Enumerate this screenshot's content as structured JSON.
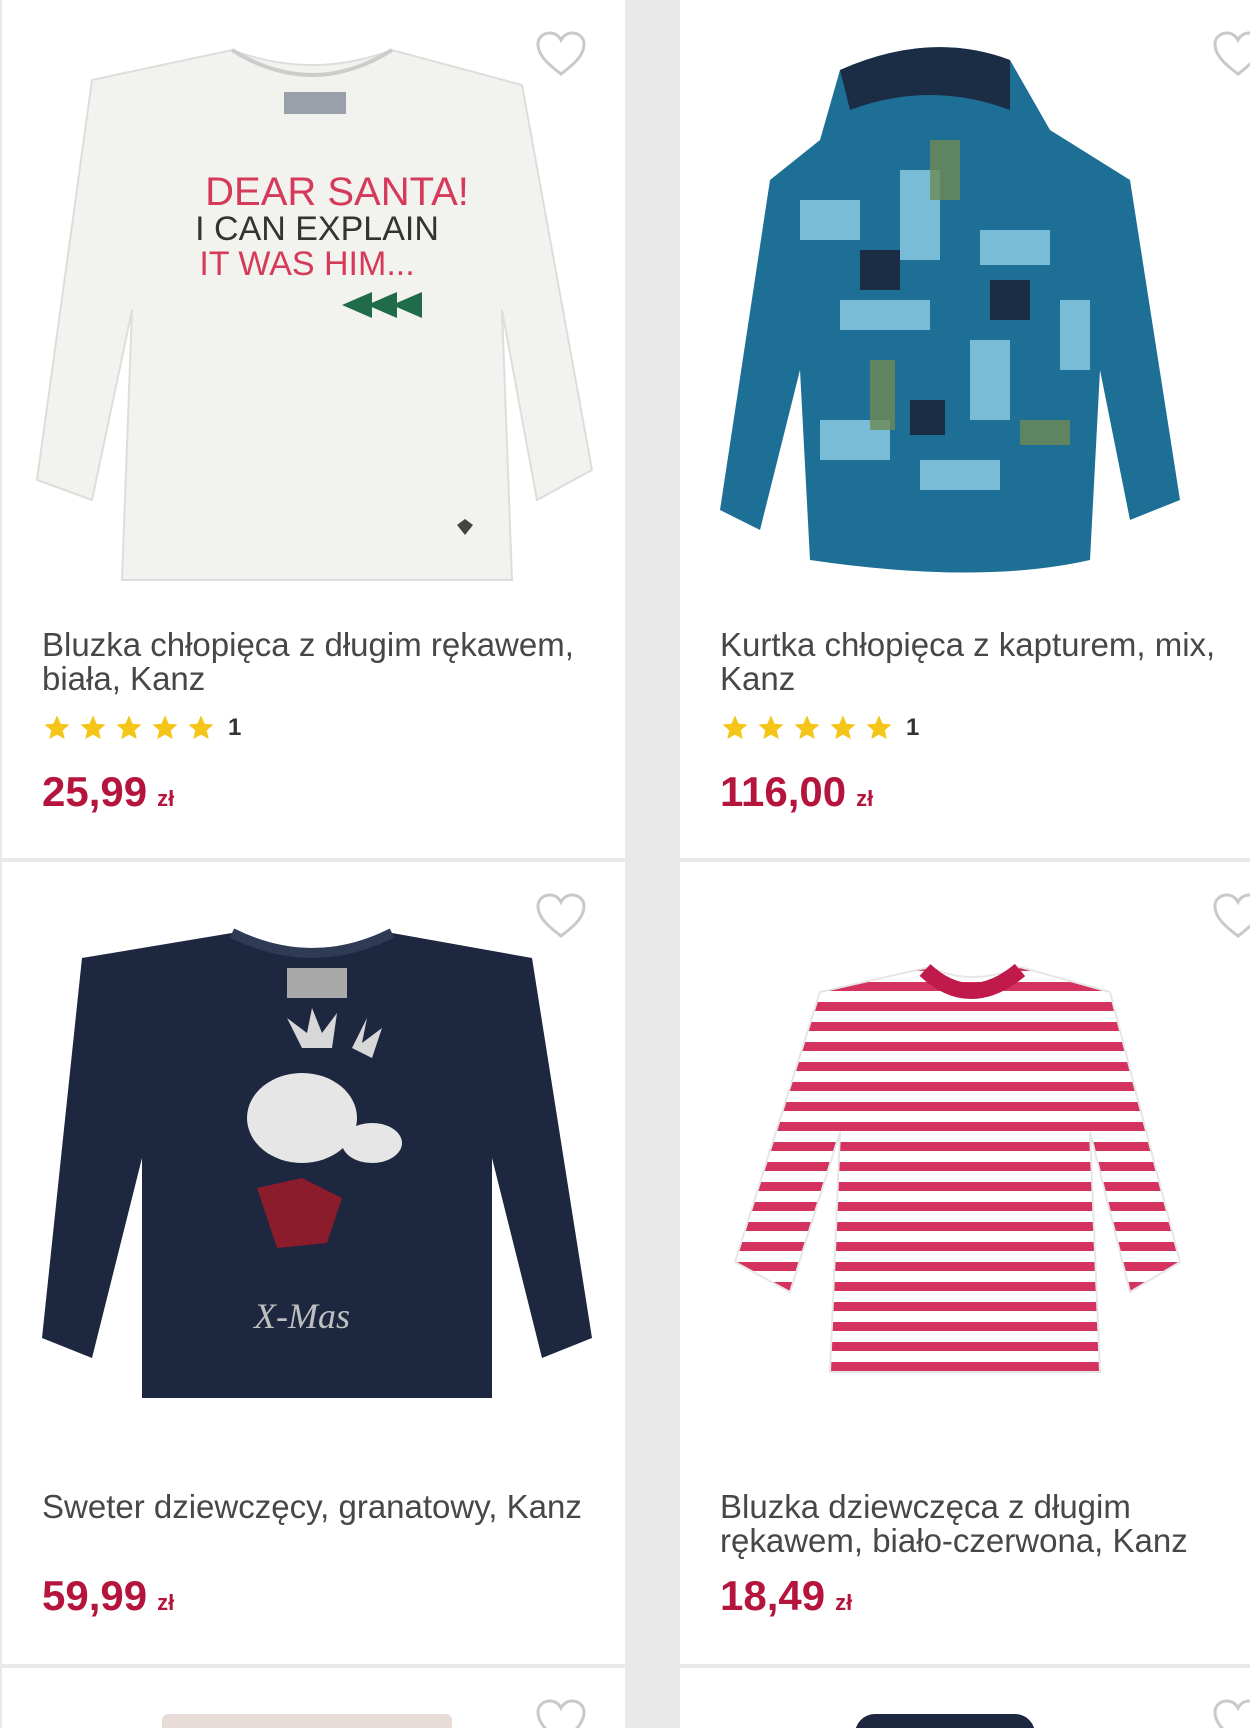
{
  "colors": {
    "price": "#b5153c",
    "star": "#f5c518",
    "heart": "#c9c9c9"
  },
  "products": [
    {
      "title": "Bluzka chłopięca z długim rękawem, biała, Kanz",
      "rating_count": "1",
      "stars": 5,
      "price": "25,99",
      "currency": "zł",
      "print_lines": [
        "DEAR SANTA!",
        "I CAN EXPLAIN",
        "IT WAS HIM..."
      ]
    },
    {
      "title": "Kurtka chłopięca z kapturem, mix, Kanz",
      "rating_count": "1",
      "stars": 5,
      "price": "116,00",
      "currency": "zł"
    },
    {
      "title": "Sweter dziewczęcy, granatowy, Kanz",
      "price": "59,99",
      "currency": "zł",
      "print_text": "X-Mas"
    },
    {
      "title": "Bluzka dziewczęca z długim rękawem, biało-czerwona, Kanz",
      "price": "18,49",
      "currency": "zł"
    }
  ]
}
